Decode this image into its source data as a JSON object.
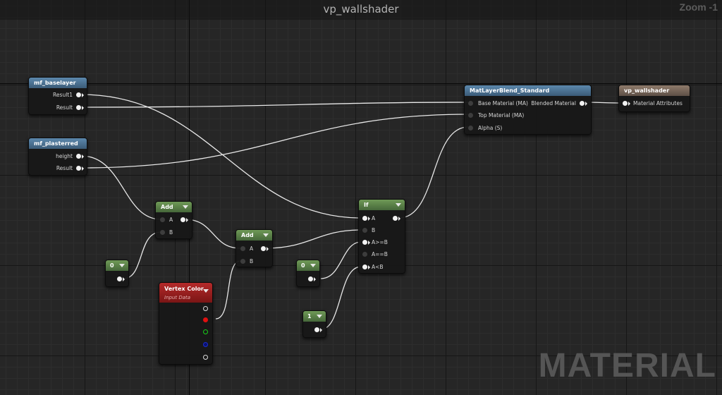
{
  "graph": {
    "title": "vp_wallshader",
    "zoom": "Zoom -1",
    "watermark": "MATERIAL"
  },
  "nodes": {
    "mf_baselayer": {
      "title": "mf_baselayer",
      "outputs": [
        "Result1",
        "Result"
      ]
    },
    "mf_plasterred": {
      "title": "mf_plasterred",
      "outputs": [
        "height",
        "Result"
      ]
    },
    "add1": {
      "title": "Add",
      "inputs": [
        "A",
        "B"
      ]
    },
    "add2": {
      "title": "Add",
      "inputs": [
        "A",
        "B"
      ]
    },
    "const0_left": {
      "title": "0"
    },
    "const0_right": {
      "title": "0"
    },
    "const1": {
      "title": "1"
    },
    "vertex_color": {
      "title": "Vertex Color",
      "subtitle": "Input Data"
    },
    "if_node": {
      "title": "If",
      "inputs": [
        "A",
        "B",
        "A>=B",
        "A==B",
        "A<B"
      ]
    },
    "blend": {
      "title": "MatLayerBlend_Standard",
      "inputs": [
        "Base Material (MA)",
        "Top Material (MA)",
        "Alpha (S)"
      ],
      "output": "Blended Material"
    },
    "result": {
      "title": "vp_wallshader",
      "input": "Material Attributes"
    }
  },
  "colors": {
    "wire": "#e8e8e8",
    "header_blue": "#4a6f90",
    "header_green": "#5a8046",
    "header_brown": "#7a6658",
    "header_red": "#a02020"
  }
}
